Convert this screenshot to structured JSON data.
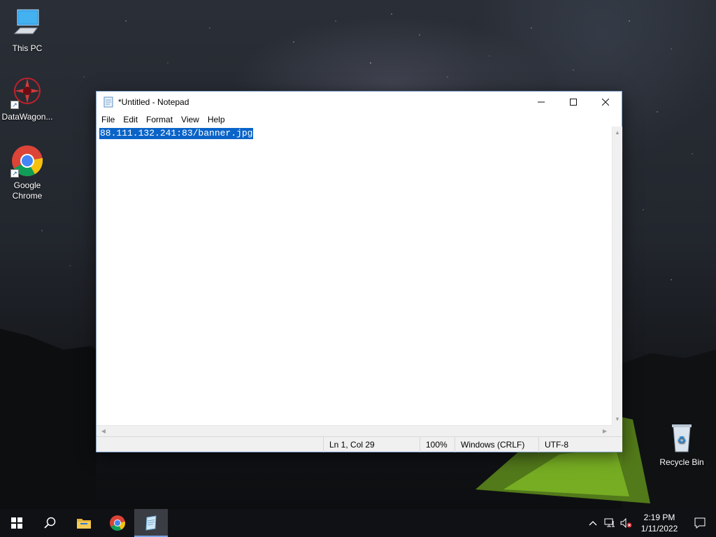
{
  "desktop": {
    "icons": [
      {
        "label": "This PC",
        "icon": "this-pc-icon"
      },
      {
        "label": "DataWagon...",
        "icon": "datawagon-icon"
      },
      {
        "label": "Google Chrome",
        "icon": "chrome-icon"
      },
      {
        "label": "Recycle Bin",
        "icon": "recycle-bin-icon"
      }
    ]
  },
  "notepad": {
    "title": "*Untitled - Notepad",
    "menu": [
      "File",
      "Edit",
      "Format",
      "View",
      "Help"
    ],
    "content": "88.111.132.241:83/banner.jpg",
    "content_selected": true,
    "status": {
      "position": "Ln 1, Col 29",
      "zoom": "100%",
      "line_ending": "Windows (CRLF)",
      "encoding": "UTF-8"
    }
  },
  "taskbar": {
    "apps": [
      {
        "name": "start",
        "icon": "windows-start-icon"
      },
      {
        "name": "search",
        "icon": "search-icon"
      },
      {
        "name": "file-explorer",
        "icon": "folder-icon"
      },
      {
        "name": "chrome",
        "icon": "chrome-icon"
      },
      {
        "name": "notepad",
        "icon": "notepad-icon",
        "active": true
      }
    ],
    "clock": {
      "time": "2:19 PM",
      "date": "1/11/2022"
    }
  },
  "colors": {
    "selection": "#0a64c8",
    "taskbar": "#101114",
    "active_indicator": "#78a6e6"
  }
}
